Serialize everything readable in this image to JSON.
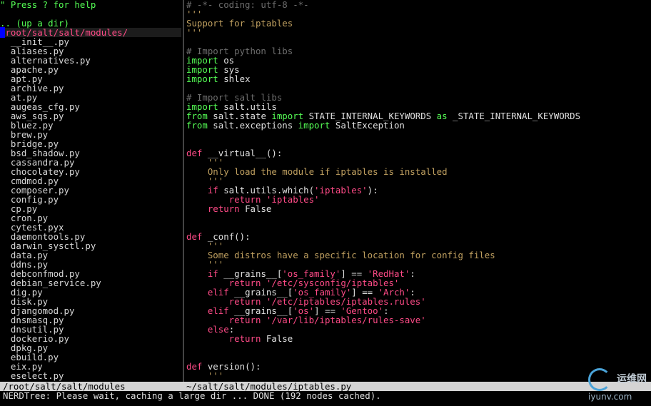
{
  "nerdtree": {
    "help_hint": "\" Press ? for help",
    "up_dir": ".. (up a dir)",
    "root_path": "root/salt/salt/modules/",
    "files": [
      "__init__.py",
      "aliases.py",
      "alternatives.py",
      "apache.py",
      "apt.py",
      "archive.py",
      "at.py",
      "augeas_cfg.py",
      "aws_sqs.py",
      "bluez.py",
      "brew.py",
      "bridge.py",
      "bsd_shadow.py",
      "cassandra.py",
      "chocolatey.py",
      "cmdmod.py",
      "composer.py",
      "config.py",
      "cp.py",
      "cron.py",
      "cytest.pyx",
      "daemontools.py",
      "darwin_sysctl.py",
      "data.py",
      "ddns.py",
      "debconfmod.py",
      "debian_service.py",
      "dig.py",
      "disk.py",
      "djangomod.py",
      "dnsmasq.py",
      "dnsutil.py",
      "dockerio.py",
      "dpkg.py",
      "ebuild.py",
      "eix.py",
      "eselect.py"
    ]
  },
  "editor": {
    "lines": [
      [
        [
          "comment",
          "# -*- coding: utf-8 -*-"
        ]
      ],
      [
        [
          "doc",
          "'''"
        ]
      ],
      [
        [
          "doc",
          "Support for iptables"
        ]
      ],
      [
        [
          "doc",
          "'''"
        ]
      ],
      [],
      [
        [
          "comment",
          "# Import python libs"
        ]
      ],
      [
        [
          "kw",
          "import"
        ],
        [
          "txt",
          " os"
        ]
      ],
      [
        [
          "kw",
          "import"
        ],
        [
          "txt",
          " sys"
        ]
      ],
      [
        [
          "kw",
          "import"
        ],
        [
          "txt",
          " shlex"
        ]
      ],
      [],
      [
        [
          "comment",
          "# Import salt libs"
        ]
      ],
      [
        [
          "kw",
          "import"
        ],
        [
          "txt",
          " salt.utils"
        ]
      ],
      [
        [
          "kw",
          "from"
        ],
        [
          "txt",
          " salt.state "
        ],
        [
          "kw",
          "import"
        ],
        [
          "txt",
          " STATE_INTERNAL_KEYWORDS "
        ],
        [
          "kw",
          "as"
        ],
        [
          "txt",
          " _STATE_INTERNAL_KEYWORDS"
        ]
      ],
      [
        [
          "kw",
          "from"
        ],
        [
          "txt",
          " salt.exceptions "
        ],
        [
          "kw",
          "import"
        ],
        [
          "txt",
          " SaltException"
        ]
      ],
      [],
      [],
      [
        [
          "str",
          "def"
        ],
        [
          "txt",
          " __virtual__():"
        ]
      ],
      [
        [
          "doc",
          "    '''"
        ]
      ],
      [
        [
          "doc",
          "    Only load the module if iptables is installed"
        ]
      ],
      [
        [
          "doc",
          "    '''"
        ]
      ],
      [
        [
          "str",
          "    if"
        ],
        [
          "txt",
          " salt.utils.which("
        ],
        [
          "str",
          "'iptables'"
        ],
        [
          "txt",
          "):"
        ]
      ],
      [
        [
          "str",
          "        return"
        ],
        [
          "str",
          " 'iptables'"
        ]
      ],
      [
        [
          "str",
          "    return"
        ],
        [
          "txt",
          " False"
        ]
      ],
      [],
      [],
      [
        [
          "str",
          "def"
        ],
        [
          "txt",
          " _conf():"
        ]
      ],
      [
        [
          "doc",
          "    '''"
        ]
      ],
      [
        [
          "doc",
          "    Some distros have a specific location for config files"
        ]
      ],
      [
        [
          "doc",
          "    '''"
        ]
      ],
      [
        [
          "str",
          "    if"
        ],
        [
          "txt",
          " __grains__["
        ],
        [
          "str",
          "'os_family'"
        ],
        [
          "txt",
          "] == "
        ],
        [
          "str",
          "'RedHat'"
        ],
        [
          "txt",
          ":"
        ]
      ],
      [
        [
          "str",
          "        return"
        ],
        [
          "str",
          " '/etc/sysconfig/iptables'"
        ]
      ],
      [
        [
          "str",
          "    elif"
        ],
        [
          "txt",
          " __grains__["
        ],
        [
          "str",
          "'os_family'"
        ],
        [
          "txt",
          "] == "
        ],
        [
          "str",
          "'Arch'"
        ],
        [
          "txt",
          ":"
        ]
      ],
      [
        [
          "str",
          "        return"
        ],
        [
          "str",
          " '/etc/iptables/iptables.rules'"
        ]
      ],
      [
        [
          "str",
          "    elif"
        ],
        [
          "txt",
          " __grains__["
        ],
        [
          "str",
          "'os'"
        ],
        [
          "txt",
          "] == "
        ],
        [
          "str",
          "'Gentoo'"
        ],
        [
          "txt",
          ":"
        ]
      ],
      [
        [
          "str",
          "        return"
        ],
        [
          "str",
          " '/var/lib/iptables/rules-save'"
        ]
      ],
      [
        [
          "str",
          "    else"
        ],
        [
          "txt",
          ":"
        ]
      ],
      [
        [
          "str",
          "        return"
        ],
        [
          "txt",
          " False"
        ]
      ],
      [],
      [],
      [
        [
          "str",
          "def"
        ],
        [
          "txt",
          " version():"
        ]
      ],
      [
        [
          "doc",
          "    '''"
        ]
      ]
    ]
  },
  "statusbar": {
    "left": "/root/salt/salt/modules",
    "right": "~/salt/salt/modules/iptables.py"
  },
  "cmdline": "NERDTree: Please wait, caching a large dir ... DONE (192 nodes cached).",
  "watermark": {
    "cn": "运维网",
    "url": "iyunv.com"
  }
}
